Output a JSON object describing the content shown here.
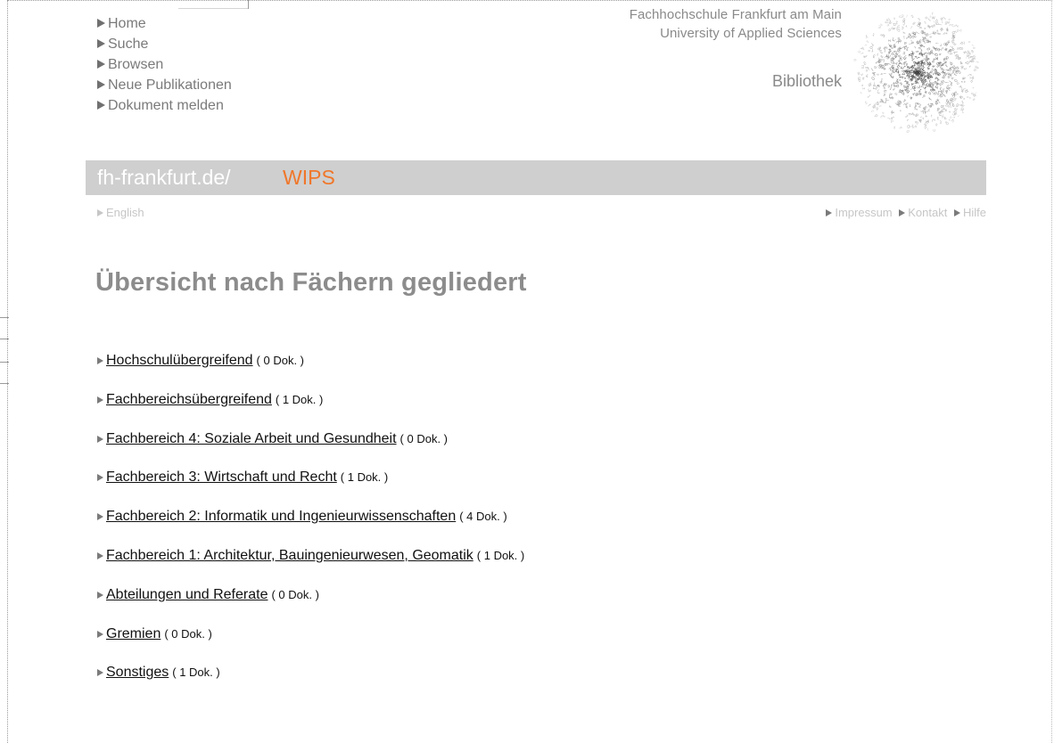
{
  "nav": {
    "items": [
      {
        "label": "Home"
      },
      {
        "label": "Suche"
      },
      {
        "label": "Browsen"
      },
      {
        "label": "Neue Publikationen"
      },
      {
        "label": "Dokument melden"
      }
    ]
  },
  "institution": {
    "line1": "Fachhochschule Frankfurt am Main",
    "line2": "University of Applied Sciences",
    "library": "Bibliothek"
  },
  "banner": {
    "domain": "fh-frankfurt.de/",
    "product": "WIPS"
  },
  "secondary": {
    "language": "English",
    "links": [
      {
        "label": "Impressum"
      },
      {
        "label": "Kontakt"
      },
      {
        "label": "Hilfe"
      }
    ]
  },
  "page": {
    "title": "Übersicht nach Fächern gegliedert"
  },
  "subjects": [
    {
      "label": "Hochschulübergreifend",
      "count": "( 0 Dok. )"
    },
    {
      "label": "Fachbereichsübergreifend",
      "count": "( 1 Dok. )"
    },
    {
      "label": "Fachbereich 4: Soziale Arbeit und Gesundheit",
      "count": "( 0 Dok. )"
    },
    {
      "label": "Fachbereich 3: Wirtschaft und Recht",
      "count": "( 1 Dok. )"
    },
    {
      "label": "Fachbereich 2: Informatik und Ingenieurwissenschaften",
      "count": "( 4 Dok. )"
    },
    {
      "label": "Fachbereich 1: Architektur, Bauingenieurwesen, Geomatik",
      "count": "( 1 Dok. )"
    },
    {
      "label": "Abteilungen und Referate",
      "count": "( 0 Dok. )"
    },
    {
      "label": "Gremien",
      "count": "( 0 Dok. )"
    },
    {
      "label": "Sonstiges",
      "count": "( 1 Dok. )"
    }
  ],
  "colors": {
    "banner_bg": "#cfcfcf",
    "accent": "#f0772a",
    "muted_text": "#8a8a8a",
    "link_text": "#111111"
  },
  "icons": {
    "bullet": "triangle-right-icon",
    "logo": "letter-cloud-logo"
  }
}
